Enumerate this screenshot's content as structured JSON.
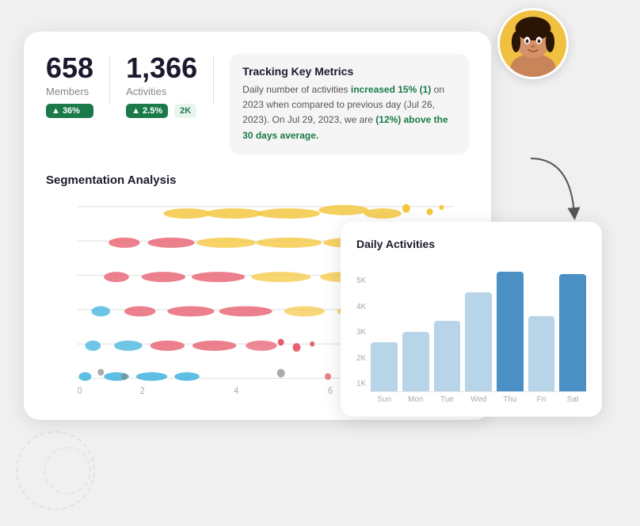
{
  "main_card": {
    "members_value": "658",
    "members_label": "Members",
    "members_badge": "▲ 36%",
    "activities_value": "1,366",
    "activities_label": "Activities",
    "activities_badge": "▲ 2.5%",
    "activities_badge2": "2K",
    "tracking_title": "Tracking Key Metrics",
    "tracking_text_1": "Daily number of activities ",
    "tracking_highlight_1": "increased 15% (1)",
    "tracking_text_2": " on 2023 when compared to previous day (Jul 26, 2023). On Jul 29, 2023, we are ",
    "tracking_highlight_2": "(12%) above the 30 days average.",
    "segmentation_title": "Segmentation Analysis"
  },
  "daily_card": {
    "title": "Daily Activities",
    "y_labels": [
      "5K",
      "4K",
      "3K",
      "2K",
      "1K"
    ],
    "bars": [
      {
        "label": "Sun",
        "height_pct": 38,
        "highlight": false
      },
      {
        "label": "Mon",
        "height_pct": 46,
        "highlight": false
      },
      {
        "label": "Tue",
        "height_pct": 54,
        "highlight": false
      },
      {
        "label": "Wed",
        "height_pct": 76,
        "highlight": false
      },
      {
        "label": "Thu",
        "height_pct": 92,
        "highlight": true
      },
      {
        "label": "Fri",
        "height_pct": 58,
        "highlight": false
      },
      {
        "label": "Sat",
        "height_pct": 90,
        "highlight": true
      }
    ]
  }
}
